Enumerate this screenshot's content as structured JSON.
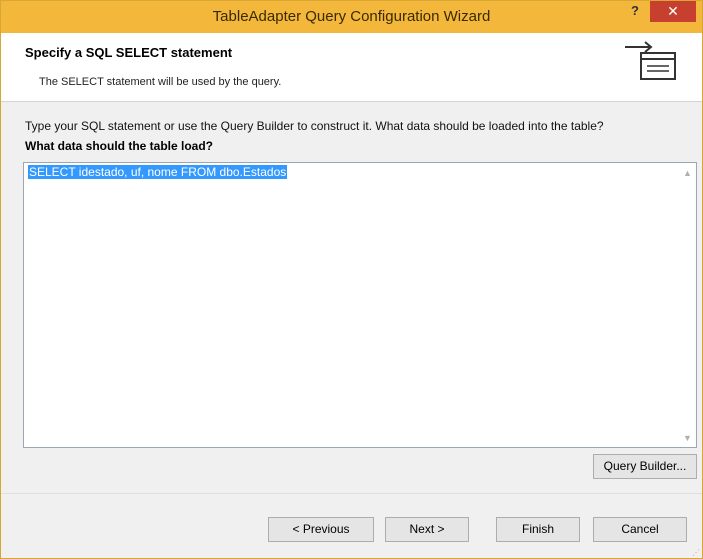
{
  "window": {
    "title": "TableAdapter Query Configuration Wizard",
    "help_label": "?",
    "close_label": "✕"
  },
  "header": {
    "title": "Specify a SQL SELECT statement",
    "subtitle": "The SELECT statement will be used by the query.",
    "icon": "wizard-step-icon"
  },
  "main": {
    "instruction": "Type your SQL statement or use the Query Builder to construct it. What data should be loaded into the table?",
    "question": "What data should the table load?",
    "sql_value": "SELECT idestado, uf, nome FROM dbo.Estados",
    "query_builder_label": "Query Builder..."
  },
  "footer": {
    "previous_label": "< Previous",
    "next_label": "Next >",
    "finish_label": "Finish",
    "cancel_label": "Cancel"
  },
  "colors": {
    "titlebar": "#f3b73c",
    "close": "#c7402f",
    "selection": "#3399ff"
  }
}
